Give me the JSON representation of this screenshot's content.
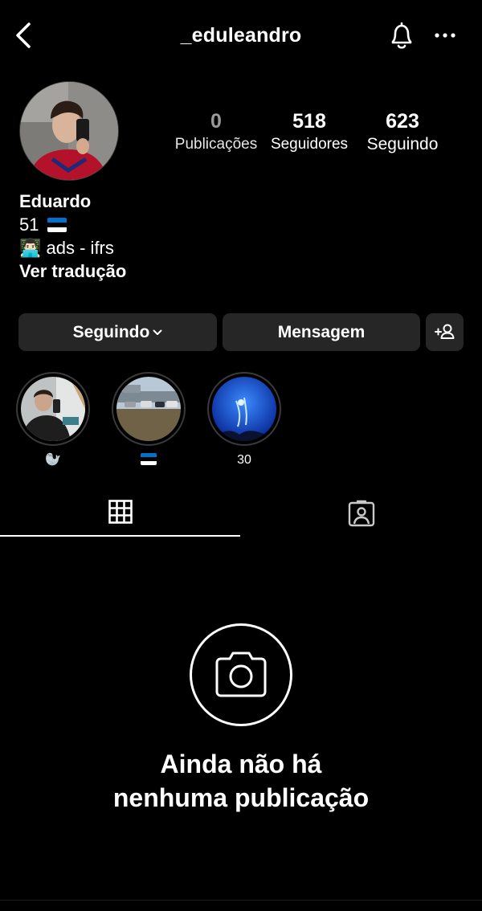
{
  "header": {
    "username": "_eduleandro"
  },
  "profile": {
    "stats": {
      "posts": {
        "value": "0",
        "label": "Publicações"
      },
      "followers": {
        "value": "518",
        "label": "Seguidores"
      },
      "following": {
        "value": "623",
        "label": "Seguindo"
      }
    },
    "bio": {
      "name": "Eduardo",
      "line1": "51",
      "line2_emoji": "👨🏻‍💻",
      "line2_text": "ads - ifrs",
      "translate": "Ver tradução"
    }
  },
  "actions": {
    "following_label": "Seguindo",
    "message_label": "Mensagem"
  },
  "highlights": [
    {
      "caption": "🦭"
    },
    {
      "caption": ""
    },
    {
      "caption": "30"
    }
  ],
  "empty_state": {
    "line1": "Ainda não há",
    "line2": "nenhuma publicação"
  },
  "colors": {
    "background": "#000000",
    "button_bg": "#262626",
    "flag_blue": "#0072CE",
    "flag_black": "#000000",
    "flag_white": "#FFFFFF"
  },
  "icons": [
    "back-arrow-icon",
    "bell-icon",
    "more-icon",
    "chevron-down-icon",
    "add-person-icon",
    "grid-icon",
    "tagged-icon",
    "camera-icon"
  ]
}
